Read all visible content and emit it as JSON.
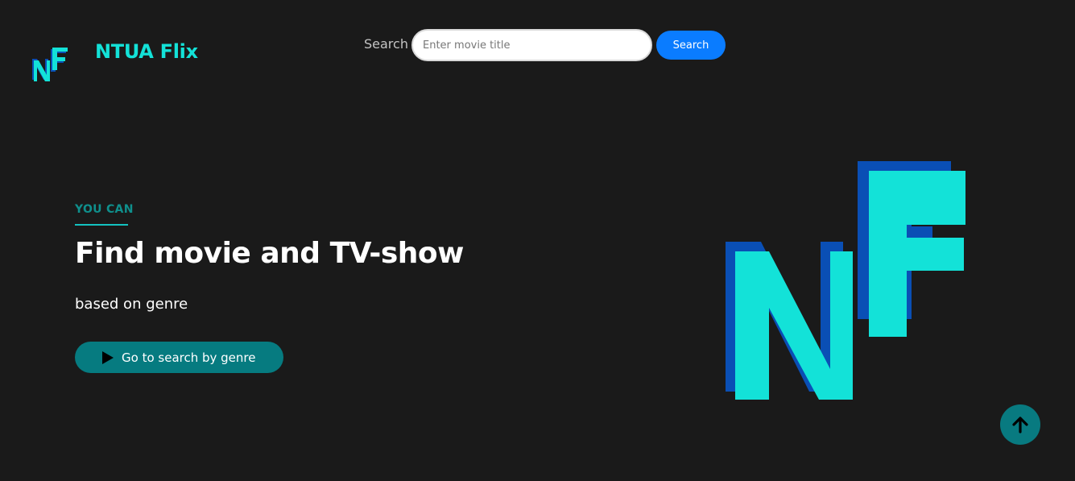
{
  "header": {
    "brand": "NTUA Flix",
    "logo_icon": "nf-logo-icon",
    "search": {
      "label": "Search",
      "placeholder": "Enter movie title",
      "value": "",
      "button_label": "Search"
    }
  },
  "hero": {
    "eyebrow": "YOU CAN",
    "title": "Find movie and TV-show",
    "subtitle": "based on genre",
    "cta_label": "Go to search by genre",
    "cta_icon": "play-icon"
  },
  "scroll_top_icon": "arrow-up-icon",
  "colors": {
    "background": "#1a1a1a",
    "brand_cyan": "#13e2d8",
    "brand_blue": "#0a4fb5",
    "search_button": "#0a7cff",
    "teal_button": "#067b80"
  }
}
